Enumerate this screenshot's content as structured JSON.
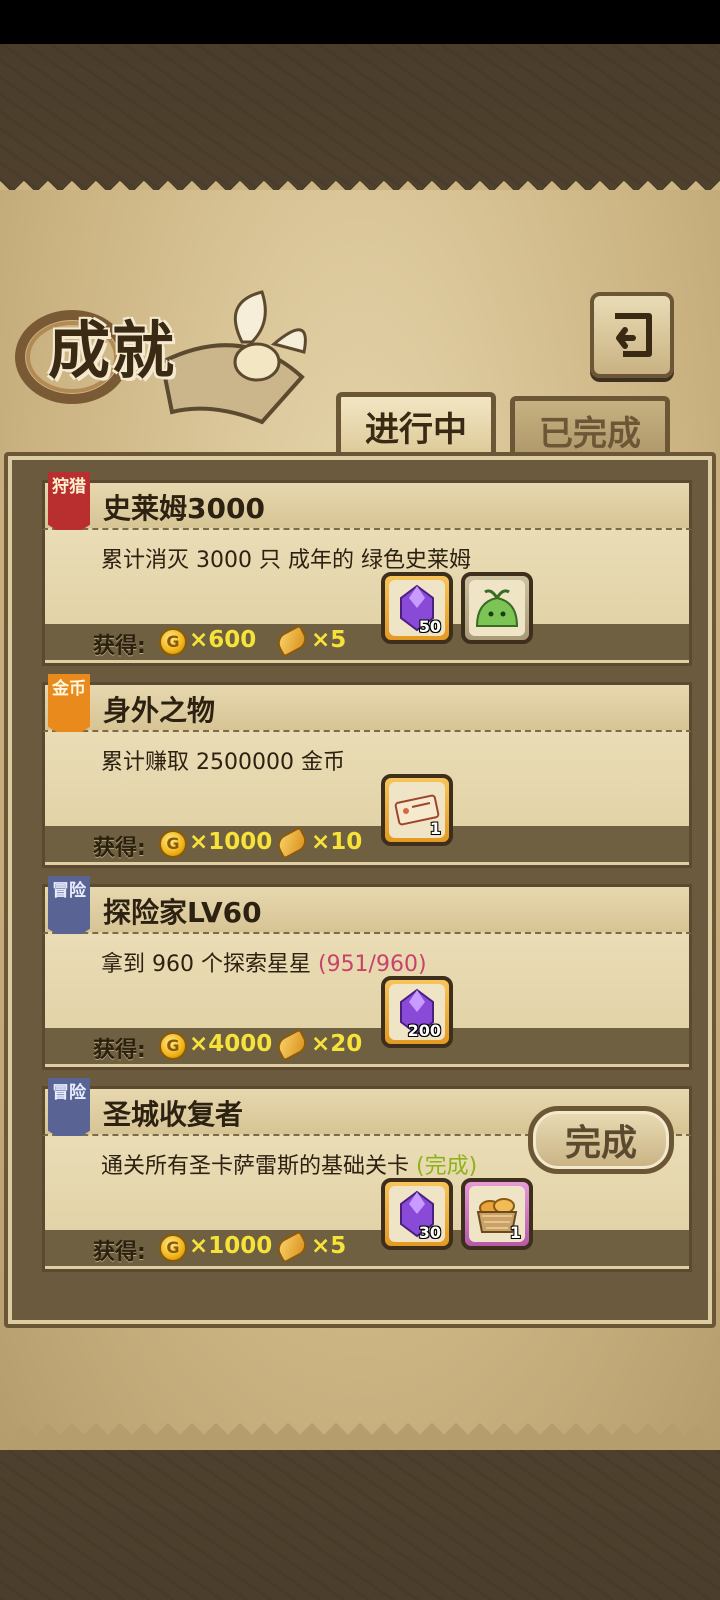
{
  "header": {
    "title": "成就",
    "tabs": [
      {
        "label": "进行中",
        "active": true
      },
      {
        "label": "已完成",
        "active": false
      }
    ]
  },
  "reward_label": "获得:",
  "coin_symbol": "G",
  "achievements": [
    {
      "badge": "狩猎",
      "badge_color": "#b92e2e",
      "title": "史莱姆3000",
      "description": "累计消灭 3000 只 成年的 绿色史莱姆",
      "progress": "",
      "gold": "×600",
      "bread": "×5",
      "items": [
        {
          "icon": "purple-gem-icon",
          "count": "50",
          "frame": "orange"
        },
        {
          "icon": "green-slime-icon",
          "count": "",
          "frame": "gray"
        }
      ]
    },
    {
      "badge": "金币",
      "badge_color": "#e88a1c",
      "title": "身外之物",
      "description": "累计赚取 2500000 金币",
      "progress": "",
      "gold": "×1000",
      "bread": "×10",
      "items": [
        {
          "icon": "ticket-icon",
          "count": "1",
          "frame": "orange"
        }
      ]
    },
    {
      "badge": "冒险",
      "badge_color": "#5a6494",
      "title": "探险家LV60",
      "description": "拿到 960 个探索星星",
      "progress": "(951/960)",
      "gold": "×4000",
      "bread": "×20",
      "items": [
        {
          "icon": "purple-gem-icon",
          "count": "200",
          "frame": "orange"
        }
      ]
    },
    {
      "badge": "冒险",
      "badge_color": "#5a6494",
      "title": "圣城收复者",
      "description": "通关所有圣卡萨雷斯的基础关卡",
      "progress": "(完成)",
      "completed_label": "完成",
      "gold": "×1000",
      "bread": "×5",
      "items": [
        {
          "icon": "purple-gem-icon",
          "count": "30",
          "frame": "orange"
        },
        {
          "icon": "bread-basket-icon",
          "count": "1",
          "frame": "pink"
        }
      ]
    }
  ]
}
